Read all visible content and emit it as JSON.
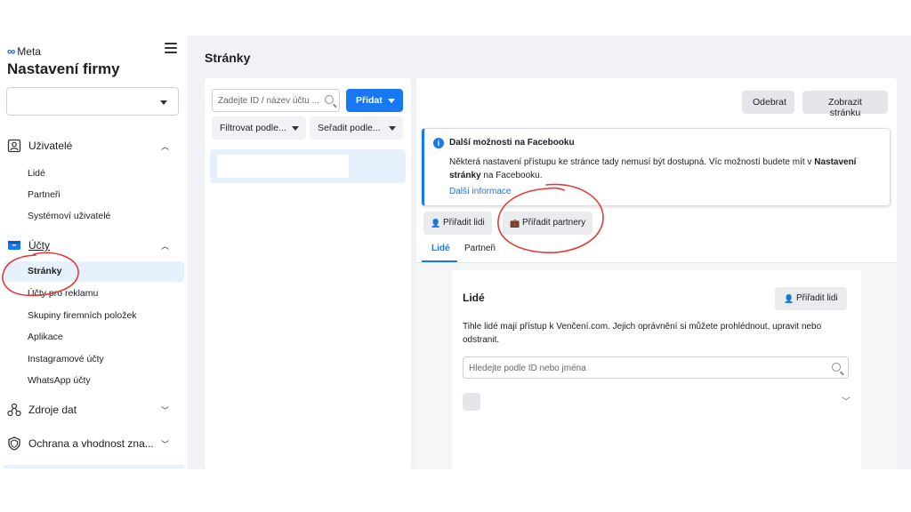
{
  "sidebar": {
    "brand": "Meta",
    "title": "Nastavení firmy",
    "business_select": "",
    "sections": {
      "users": "Uživatelé",
      "accounts": "Účty",
      "data_sources": "Zdroje dat",
      "safety": "Ochrana a vhodnost zna..."
    },
    "users_items": [
      "Lidé",
      "Partneři",
      "Systémoví uživatelé"
    ],
    "accounts_items": [
      "Stránky",
      "Účty pro reklamu",
      "Skupiny firemních položek",
      "Aplikace",
      "Instagramové účty",
      "WhatsApp účty"
    ]
  },
  "main": {
    "title": "Stránky",
    "search_placeholder": "Zadejte ID / název účtu ...",
    "add_label": "Přidat",
    "filter_label": "Filtrovat podle...",
    "sort_label": "Seřadit podle...",
    "remove_label": "Odebrat",
    "view_page_label": "Zobrazit stránku",
    "info": {
      "title": "Další možnosti na Facebooku",
      "text_before": "Některá nastavení přístupu ke stránce tady nemusí být dostupná. Víc možností budete mít v ",
      "text_bold": "Nastavení stránky",
      "text_after": " na Facebooku.",
      "link": "Další informace"
    },
    "assign_people": "Přiřadit lidi",
    "assign_partners": "Přiřadit partnery",
    "tabs": [
      "Lidé",
      "Partneři"
    ],
    "people": {
      "title": "Lidé",
      "add_label": "Přiřadit lidi",
      "description": "Tihle lidé mají přístup k Venčení.com. Jejich oprávnění si můžete prohlédnout, upravit nebo odstranit.",
      "search_placeholder": "Hledejte podle ID nebo jména"
    }
  },
  "colors": {
    "accent": "#1877f2",
    "annotation": "#e53935",
    "selected_bg": "#e7f0fd"
  },
  "icons": [
    "meta-logo-icon",
    "menu-icon",
    "users-icon",
    "briefcase-icon",
    "data-sources-icon",
    "shield-icon",
    "search-icon",
    "info-icon",
    "person-add-icon",
    "partner-icon",
    "chevron-down-icon"
  ]
}
